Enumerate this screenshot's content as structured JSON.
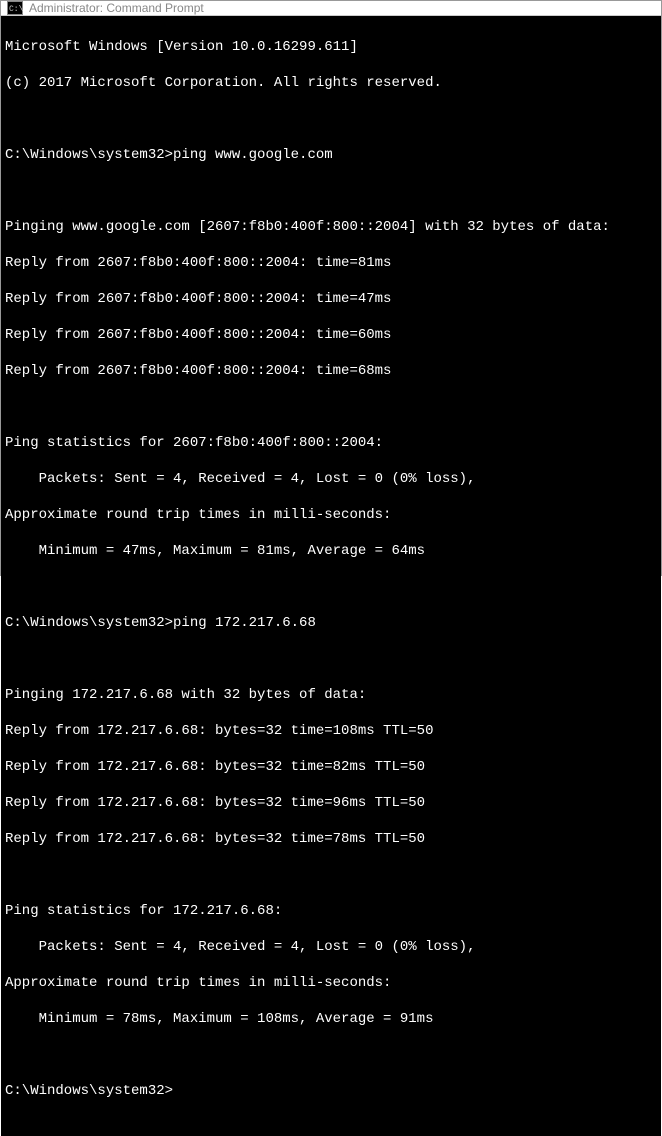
{
  "window": {
    "title": "Administrator: Command Prompt"
  },
  "terminal": {
    "banner1": "Microsoft Windows [Version 10.0.16299.611]",
    "banner2": "(c) 2017 Microsoft Corporation. All rights reserved.",
    "prompt1": "C:\\Windows\\system32>ping www.google.com",
    "ping1_header": "Pinging www.google.com [2607:f8b0:400f:800::2004] with 32 bytes of data:",
    "ping1_r1": "Reply from 2607:f8b0:400f:800::2004: time=81ms",
    "ping1_r2": "Reply from 2607:f8b0:400f:800::2004: time=47ms",
    "ping1_r3": "Reply from 2607:f8b0:400f:800::2004: time=60ms",
    "ping1_r4": "Reply from 2607:f8b0:400f:800::2004: time=68ms",
    "ping1_stats_hdr": "Ping statistics for 2607:f8b0:400f:800::2004:",
    "ping1_packets": "    Packets: Sent = 4, Received = 4, Lost = 0 (0% loss),",
    "ping1_rtt_hdr": "Approximate round trip times in milli-seconds:",
    "ping1_rtt": "    Minimum = 47ms, Maximum = 81ms, Average = 64ms",
    "prompt2": "C:\\Windows\\system32>ping 172.217.6.68",
    "ping2_header": "Pinging 172.217.6.68 with 32 bytes of data:",
    "ping2_r1": "Reply from 172.217.6.68: bytes=32 time=108ms TTL=50",
    "ping2_r2": "Reply from 172.217.6.68: bytes=32 time=82ms TTL=50",
    "ping2_r3": "Reply from 172.217.6.68: bytes=32 time=96ms TTL=50",
    "ping2_r4": "Reply from 172.217.6.68: bytes=32 time=78ms TTL=50",
    "ping2_stats_hdr": "Ping statistics for 172.217.6.68:",
    "ping2_packets": "    Packets: Sent = 4, Received = 4, Lost = 0 (0% loss),",
    "ping2_rtt_hdr": "Approximate round trip times in milli-seconds:",
    "ping2_rtt": "    Minimum = 78ms, Maximum = 108ms, Average = 91ms",
    "prompt3": "C:\\Windows\\system32>"
  }
}
